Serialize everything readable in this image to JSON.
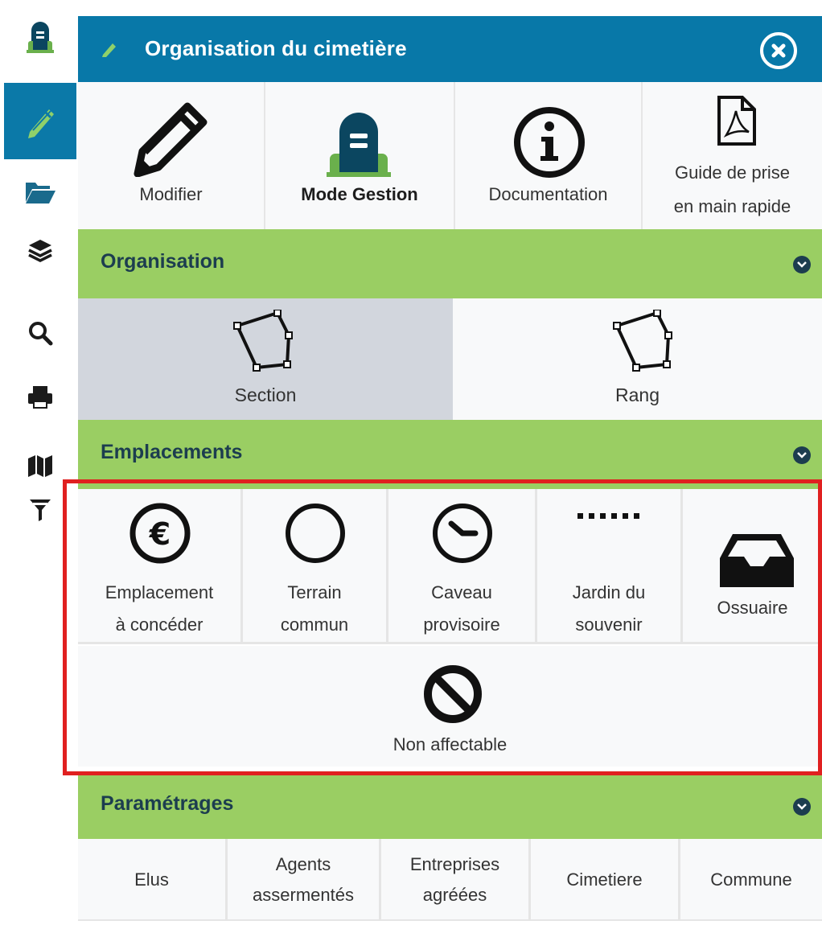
{
  "colors": {
    "primary": "#0878a8",
    "section_bar": "#9ace63",
    "section_text": "#1c3d4f",
    "selected": "#d2d6dd",
    "highlight": "#e02020"
  },
  "rail": {
    "items": [
      {
        "icon": "tombstone-icon"
      },
      {
        "icon": "pencil-icon",
        "active": true
      },
      {
        "icon": "folder-open-icon"
      },
      {
        "icon": "layers-icon"
      },
      {
        "icon": "search-icon"
      },
      {
        "icon": "print-icon"
      },
      {
        "icon": "map-icon"
      },
      {
        "icon": "filter-icon"
      }
    ]
  },
  "header": {
    "title": "Organisation du cimetière",
    "close_icon": "close-icon"
  },
  "tools": [
    {
      "label": "Modifier",
      "icon": "pencil-icon"
    },
    {
      "label": "Mode Gestion",
      "icon": "tombstone-icon",
      "bold": true
    },
    {
      "label": "Documentation",
      "icon": "info-icon"
    },
    {
      "label_line1": "Guide de prise",
      "label_line2": "en main rapide",
      "icon": "pdf-icon"
    }
  ],
  "sections": {
    "organisation": {
      "title": "Organisation",
      "items": [
        {
          "label": "Section",
          "icon": "polygon-icon",
          "selected": true
        },
        {
          "label": "Rang",
          "icon": "polygon-icon"
        }
      ]
    },
    "emplacements": {
      "title": "Emplacements",
      "items": [
        {
          "line1": "Emplacement",
          "line2": "à concéder",
          "icon": "euro-icon"
        },
        {
          "line1": "Terrain",
          "line2": "commun",
          "icon": "circle-icon"
        },
        {
          "line1": "Caveau",
          "line2": "provisoire",
          "icon": "clock-icon"
        },
        {
          "line1": "Jardin du",
          "line2": "souvenir",
          "icon": "dotted-line-icon"
        },
        {
          "line1": "Ossuaire",
          "icon": "inbox-icon"
        }
      ],
      "extra": {
        "label": "Non affectable",
        "icon": "ban-icon"
      }
    },
    "parametrages": {
      "title": "Paramétrages",
      "items": [
        {
          "line1": "Elus"
        },
        {
          "line1": "Agents",
          "line2": "assermentés"
        },
        {
          "line1": "Entreprises",
          "line2": "agréées"
        },
        {
          "line1": "Cimetiere"
        },
        {
          "line1": "Commune"
        }
      ]
    }
  }
}
